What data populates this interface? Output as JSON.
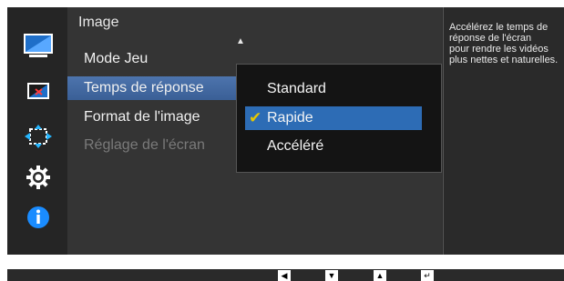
{
  "menu": {
    "title": "Image",
    "items": [
      {
        "label": "Mode Jeu",
        "selected": false,
        "disabled": false
      },
      {
        "label": "Temps de réponse",
        "selected": true,
        "disabled": false
      },
      {
        "label": "Format de l'image",
        "selected": false,
        "disabled": false
      },
      {
        "label": "Réglage de l'écran",
        "selected": false,
        "disabled": true
      }
    ]
  },
  "submenu": {
    "options": [
      {
        "label": "Standard",
        "selected": false
      },
      {
        "label": "Rapide",
        "selected": true,
        "check": "✔"
      },
      {
        "label": "Accéléré",
        "selected": false
      }
    ]
  },
  "help": {
    "lines": [
      "Accélérez le temps de",
      "réponse de l'écran",
      "pour rendre les vidéos",
      "plus nettes et naturelles."
    ]
  },
  "sidebar": {
    "icons": [
      "monitor-icon",
      "color-icon",
      "size-position-icon",
      "gear-icon",
      "info-icon"
    ]
  },
  "footer": {
    "keys": [
      "◀",
      "▼",
      "▲",
      "↵"
    ]
  },
  "colors": {
    "selected_item": "#4d74ad",
    "selected_option": "#2d6cb5",
    "checkmark": "#e6c800",
    "info": "#1a8cff"
  }
}
